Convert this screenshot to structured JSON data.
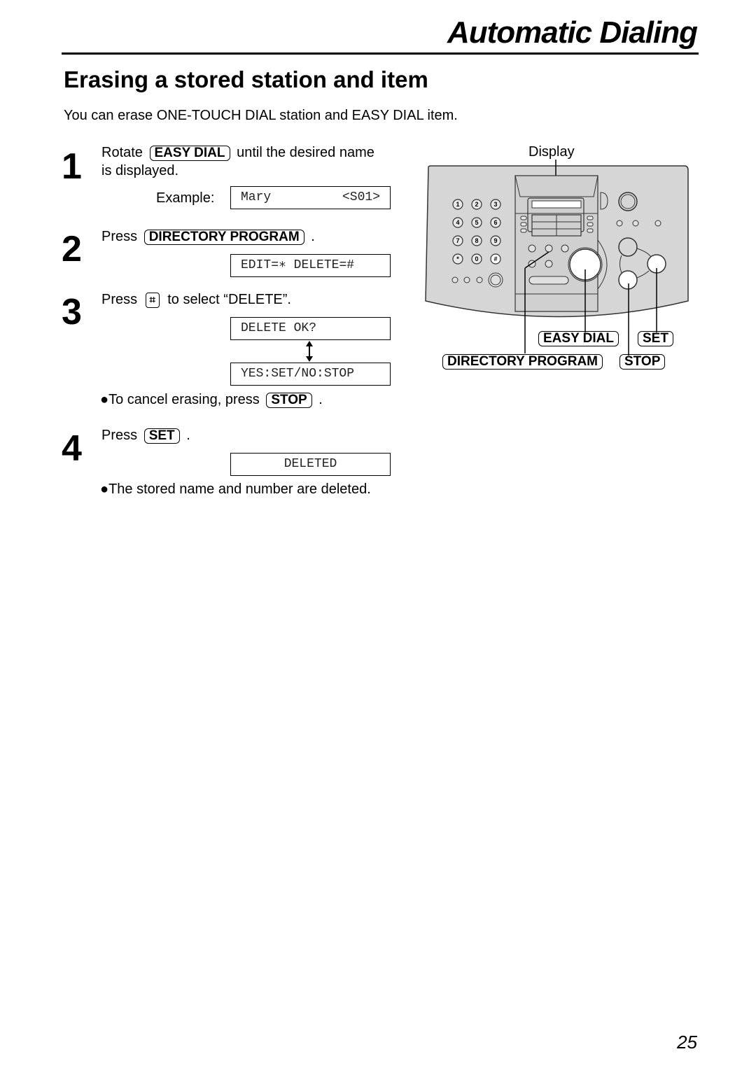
{
  "header": {
    "section_title": "Automatic Dialing",
    "heading": "Erasing a stored station and item",
    "intro": "You can erase ONE-TOUCH DIAL station and EASY DIAL item."
  },
  "steps": [
    {
      "number": "1",
      "text_before": "Rotate",
      "key": "EASY DIAL",
      "text_after": "until the desired name",
      "text_line2": "is displayed.",
      "example_label": "Example:",
      "display_left": "Mary",
      "display_right": "<S01>"
    },
    {
      "number": "2",
      "text_before": "Press",
      "key": "DIRECTORY PROGRAM",
      "text_after": ".",
      "display": "EDIT=∗ DELETE=#"
    },
    {
      "number": "3",
      "text_before": "Press",
      "key": "⌗",
      "text_after": "to select “DELETE”.",
      "display_1": "DELETE OK?",
      "display_2": "YES:SET/NO:STOP",
      "note_prefix": "●To cancel erasing, press",
      "note_key": "STOP",
      "note_suffix": "."
    },
    {
      "number": "4",
      "text_before": "Press",
      "key": "SET",
      "text_after": ".",
      "display": "DELETED",
      "note": "●The stored name and number are deleted."
    }
  ],
  "illustration": {
    "display_label": "Display",
    "callouts": {
      "easy_dial": "EASY DIAL",
      "set": "SET",
      "directory_program": "DIRECTORY PROGRAM",
      "stop": "STOP"
    },
    "keypad": [
      "1",
      "2",
      "3",
      "4",
      "5",
      "6",
      "7",
      "8",
      "9",
      "*",
      "0",
      "#"
    ],
    "panel_color": "#d6d6d6"
  },
  "footer": {
    "page_number": "25"
  }
}
